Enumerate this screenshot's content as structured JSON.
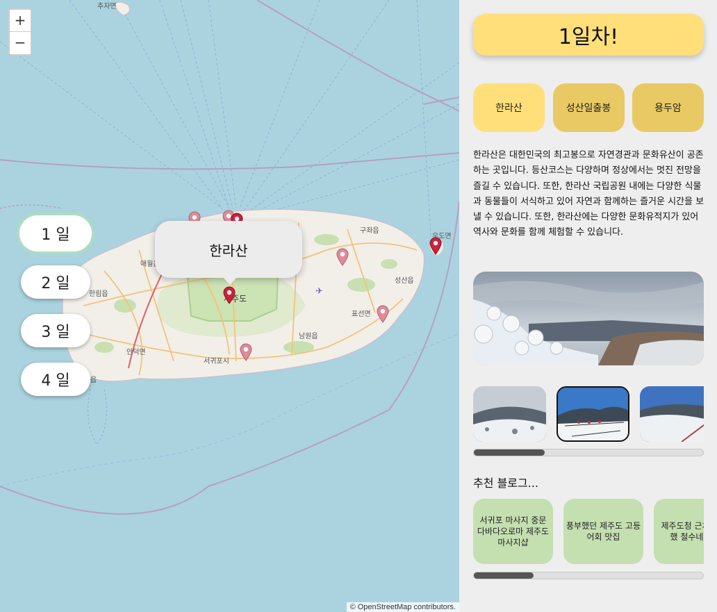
{
  "map": {
    "zoom_in": "+",
    "zoom_out": "−",
    "attribution": "© OpenStreetMap contributors.",
    "day_buttons": [
      "1 일",
      "2 일",
      "3 일",
      "4 일"
    ],
    "active_day_index": 0,
    "popup_title": "한라산",
    "labels": {
      "top": "추자면",
      "island": "제주도",
      "seogwipo": "서귀포시",
      "udo": "우도면",
      "gujwa": "구좌읍",
      "seongsan": "성산읍",
      "pyoseon": "표선면",
      "namwon": "남원읍",
      "aewol": "애월읍",
      "hallim": "한림읍",
      "andeok": "안덕면",
      "daejeong": "읍"
    }
  },
  "panel": {
    "day_title": "1일차!",
    "places": [
      "한라산",
      "성산일출봉",
      "용두암"
    ],
    "active_place_index": 0,
    "description": "한라산은 대한민국의 최고봉으로 자연경관과 문화유산이 공존하는 곳입니다. 등산코스는 다양하며 정상에서는 멋진 전망을 즐길 수 있습니다. 또한, 한라산 국립공원 내에는 다양한 식물과 동물들이 서식하고 있어 자연과 함께하는 즐거운 시간을 보낼 수 있습니다. 또한, 한라산에는 다양한 문화유적지가 있어 역사와 문화를 함께 체험할 수 있습니다.",
    "photo_scroll_percent": 31,
    "blog_heading": "추천 블로그...",
    "blogs": [
      "서귀포 마사지 중문 다바다오로마 제주도 마사지샵",
      "풍부했던 제주도 고등어회 맛집",
      "제주도청 근처 칭찬했 철수네숯불"
    ],
    "blog_scroll_percent": 26
  },
  "colors": {
    "sea": "#aad3df",
    "land": "#f2efe9",
    "park": "#c8e0b0",
    "title_yellow": "#ffdf7a",
    "place_yellow": "#e8c964",
    "blog_green": "#c4dfb0",
    "pin_active": "#d0203a",
    "pin_faded": "#e08a9a"
  }
}
